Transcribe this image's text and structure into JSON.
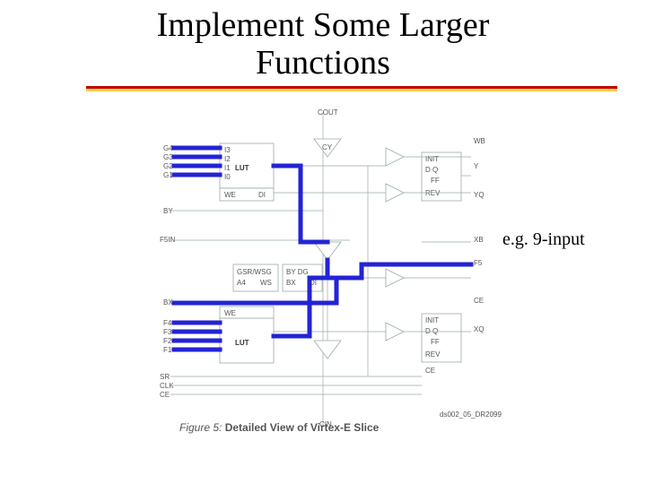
{
  "title_line1": "Implement Some Larger",
  "title_line2": "Functions",
  "annotation": "e.g. 9-input",
  "figure": {
    "label": "Figure 5:",
    "caption_bold": "Detailed View of Virtex-E Slice",
    "top_pin": "COUT",
    "bottom_pin": "CIN",
    "cy_label": "CY",
    "lut_label": "LUT",
    "we_label": "WE",
    "di_label": "DI",
    "init_label": "INIT",
    "dq_label": "D  Q",
    "ff_label": "FF",
    "rev_label": "REV",
    "ce_label": "CE",
    "lut_top_in": [
      "I3",
      "I2",
      "I1",
      "I0"
    ],
    "lut_top_left": [
      "G4",
      "G3",
      "G2",
      "G1"
    ],
    "by_label": "BY",
    "f5in_label": "F5IN",
    "gsr_label": "GSR/WSG",
    "bydg_label": "BY DG",
    "ab_label": "A4",
    "ws_label": "WS",
    "bx_label": "BX",
    "lut_bot_left": [
      "F4",
      "F3",
      "F2",
      "F1"
    ],
    "clk_labels": [
      "SR",
      "CLK",
      "CE"
    ],
    "out_right": [
      "WB",
      "Y",
      "YQ",
      "XB",
      "F5",
      "XQ",
      "CE",
      "CE"
    ],
    "credit": "ds002_05_DR2099"
  }
}
